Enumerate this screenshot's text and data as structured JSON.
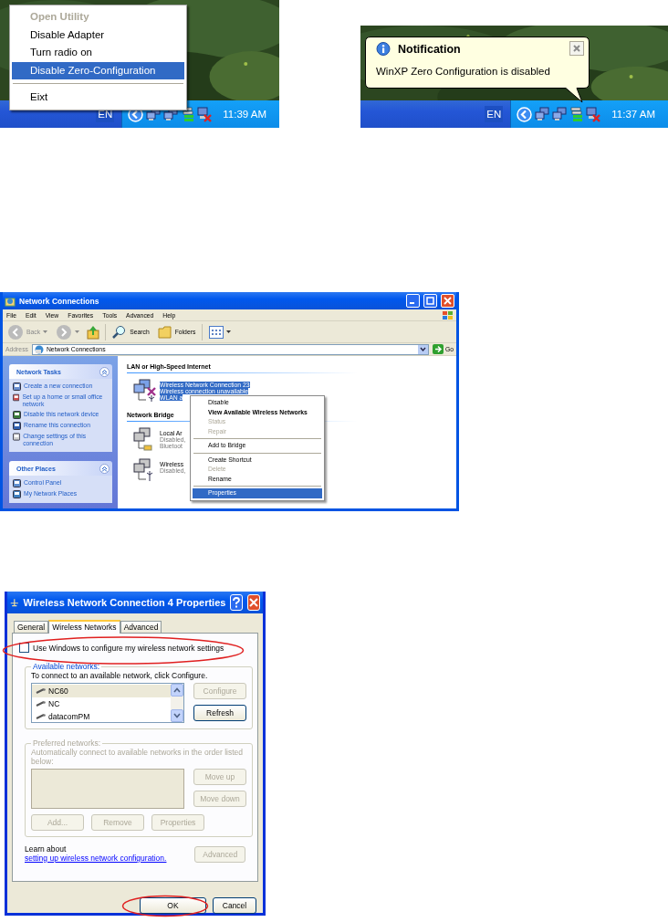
{
  "tray_menu_screen": {
    "menu": [
      [
        {
          "label": "Open Utility",
          "default": true,
          "disabled": true,
          "selected": false
        },
        {
          "label": "Disable Adapter",
          "default": false,
          "disabled": false,
          "selected": false
        },
        {
          "label": "Turn radio on",
          "default": false,
          "disabled": false,
          "selected": false
        },
        {
          "label": "Disable Zero-Configuration",
          "default": false,
          "disabled": false,
          "selected": true
        }
      ],
      [
        {
          "label": "Eixt",
          "default": false,
          "disabled": false,
          "selected": false
        }
      ]
    ],
    "taskbar": {
      "language": "EN",
      "clock": "11:39 AM"
    }
  },
  "notification_screen": {
    "balloon": {
      "title": "Notification",
      "message": "WinXP Zero Configuration is disabled"
    },
    "taskbar": {
      "language": "EN",
      "clock": "11:37 AM"
    }
  },
  "network_connections": {
    "title": "Network Connections",
    "menu_bar": [
      "File",
      "Edit",
      "View",
      "Favorites",
      "Tools",
      "Advanced",
      "Help"
    ],
    "toolbar": {
      "back": "Back",
      "search": "Search",
      "folders": "Folders"
    },
    "address": {
      "label": "Address",
      "value": "Network Connections",
      "go": "Go"
    },
    "task_panels": [
      {
        "title": "Network Tasks",
        "items": [
          "Create a new connection",
          "Set up a home or small office network",
          "Disable this network device",
          "Rename this connection",
          "Change settings of this connection"
        ]
      },
      {
        "title": "Other Places",
        "items": [
          "Control Panel",
          "My Network Places"
        ]
      }
    ],
    "groups": [
      {
        "title": "LAN or High-Speed Internet",
        "items": [
          {
            "kind": "wireless-unavailable",
            "selected": true,
            "lines": [
              "Wireless Network Connection 23",
              "Wireless connection unavailable",
              "WLAN a"
            ]
          }
        ]
      },
      {
        "title": "Network Bridge",
        "items": [
          {
            "kind": "lan",
            "selected": false,
            "lines": [
              "Local Ar",
              "Disabled,",
              "Bluetoot"
            ]
          },
          {
            "kind": "wireless",
            "selected": false,
            "lines": [
              "Wireless",
              "Disabled,"
            ]
          }
        ]
      }
    ],
    "context_menu": [
      [
        {
          "label": "Disable",
          "default": false,
          "disabled": false,
          "selected": false
        },
        {
          "label": "View Available Wireless Networks",
          "default": true,
          "disabled": false,
          "selected": false
        },
        {
          "label": "Status",
          "default": false,
          "disabled": true,
          "selected": false
        },
        {
          "label": "Repair",
          "default": false,
          "disabled": true,
          "selected": false
        }
      ],
      [
        {
          "label": "Add to Bridge",
          "default": false,
          "disabled": false,
          "selected": false
        }
      ],
      [
        {
          "label": "Create Shortcut",
          "default": false,
          "disabled": false,
          "selected": false
        },
        {
          "label": "Delete",
          "default": false,
          "disabled": true,
          "selected": false
        },
        {
          "label": "Rename",
          "default": false,
          "disabled": false,
          "selected": false
        }
      ],
      [
        {
          "label": "Properties",
          "default": false,
          "disabled": false,
          "selected": true
        }
      ]
    ]
  },
  "properties_dialog": {
    "title": "Wireless Network Connection 4 Properties",
    "tabs": [
      {
        "label": "General",
        "selected": false
      },
      {
        "label": "Wireless Networks",
        "selected": true
      },
      {
        "label": "Advanced",
        "selected": false
      }
    ],
    "use_windows_checkbox": {
      "label": "Use Windows to configure my wireless network settings",
      "checked": false
    },
    "available_networks": {
      "legend": "Available networks:",
      "instruction": "To connect to an available network, click Configure.",
      "networks": [
        {
          "name": "NC60",
          "selected": true
        },
        {
          "name": "NC",
          "selected": false
        },
        {
          "name": "datacomPM",
          "selected": false
        }
      ],
      "buttons": [
        {
          "label": "Configure",
          "disabled": true
        },
        {
          "label": "Refresh",
          "disabled": false
        }
      ]
    },
    "preferred_networks": {
      "legend": "Preferred networks:",
      "instruction": "Automatically connect to available networks in the order listed below:",
      "disabled": true,
      "side_buttons": [
        {
          "label": "Move up",
          "disabled": true
        },
        {
          "label": "Move down",
          "disabled": true
        }
      ],
      "bottom_buttons": [
        {
          "label": "Add...",
          "disabled": true
        },
        {
          "label": "Remove",
          "disabled": true
        },
        {
          "label": "Properties",
          "disabled": true
        }
      ]
    },
    "learn_more": {
      "text": "Learn about ",
      "link": "setting up wireless network configuration."
    },
    "advanced_button": {
      "label": "Advanced",
      "disabled": true
    },
    "footer_buttons": [
      {
        "label": "OK",
        "disabled": false
      },
      {
        "label": "Cancel",
        "disabled": false
      }
    ]
  }
}
